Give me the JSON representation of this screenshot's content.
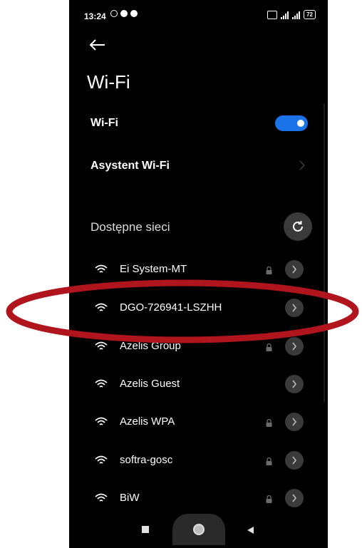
{
  "status_bar": {
    "time": "13:24",
    "battery": "72"
  },
  "header": {
    "back_icon": "arrow-left-icon",
    "title": "Wi-Fi"
  },
  "settings": {
    "wifi_label": "Wi-Fi",
    "wifi_enabled": true,
    "assistant_label": "Asystent Wi-Fi"
  },
  "networks_section": {
    "label": "Dostępne sieci",
    "refresh_icon": "refresh-icon"
  },
  "networks": [
    {
      "name": "Ei System-MT",
      "locked": true
    },
    {
      "name": "DGO-726941-LSZHH",
      "locked": false
    },
    {
      "name": "Azelis Group",
      "locked": true
    },
    {
      "name": "Azelis Guest",
      "locked": false
    },
    {
      "name": "Azelis WPA",
      "locked": true
    },
    {
      "name": "softra-gosc",
      "locked": true
    },
    {
      "name": "BiW",
      "locked": true
    }
  ],
  "colors": {
    "background": "#000000",
    "accent": "#1a73e8",
    "button_bg": "#3a3a3a",
    "highlight": "#b0141c"
  }
}
